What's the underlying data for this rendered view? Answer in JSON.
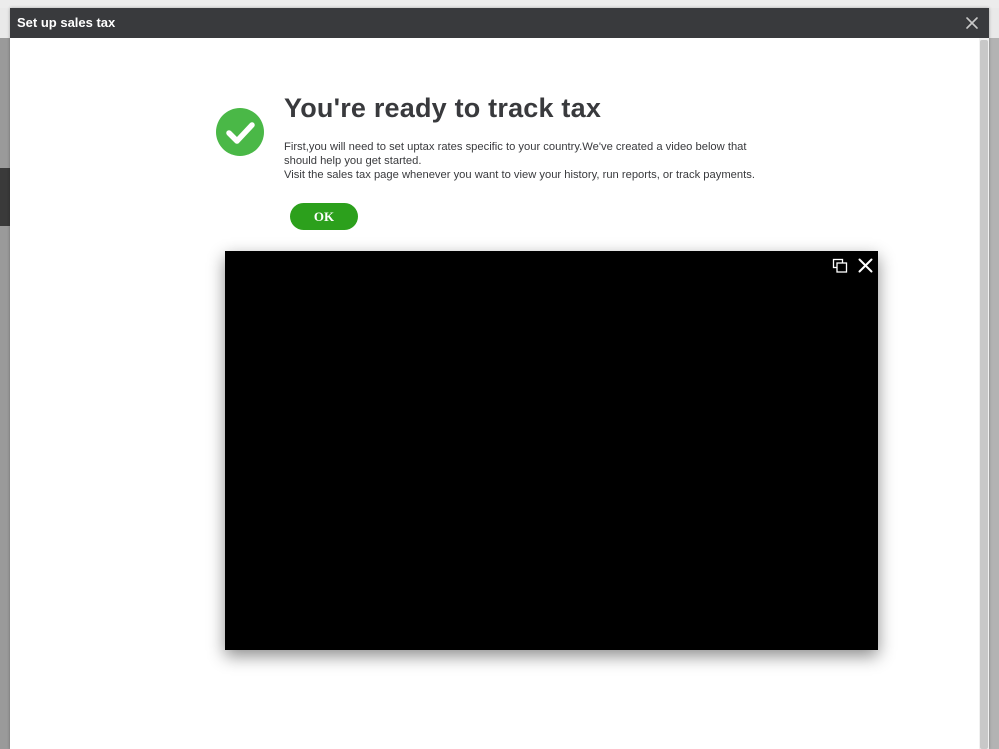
{
  "modal": {
    "title": "Set up sales tax"
  },
  "content": {
    "headline": "You're ready to track tax",
    "desc_line1": "First,you will need to set uptax rates specific to your country.We've created a video below that should help you get started.",
    "desc_line2": "Visit the sales tax page whenever you want to view your history, run reports, or track payments.",
    "ok_label": "OK"
  },
  "colors": {
    "header_bg": "#393a3d",
    "success_green": "#2ca01c",
    "check_circle": "#4ab847",
    "video_bg": "#000000"
  },
  "icons": {
    "modal_close": "close-icon",
    "success": "check-circle-icon",
    "video_popout": "popout-icon",
    "video_close": "close-icon"
  }
}
